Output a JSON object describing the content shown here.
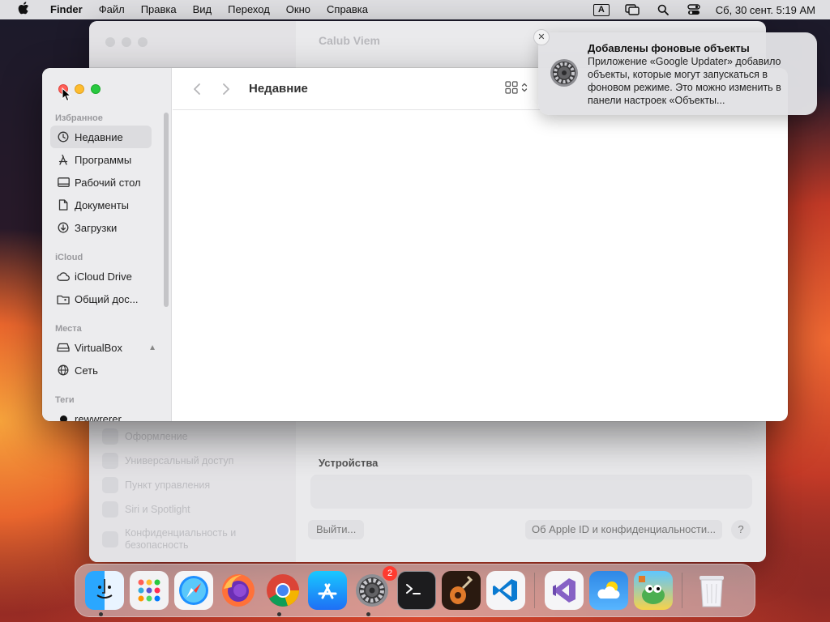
{
  "menubar": {
    "app_name": "Finder",
    "menus": [
      "Файл",
      "Правка",
      "Вид",
      "Переход",
      "Окно",
      "Справка"
    ],
    "input_indicator": "A",
    "clock": "Сб, 30 сент.  5:19 AM"
  },
  "settings_window": {
    "title": "Calub Viem",
    "sidebar_items": [
      "Оформление",
      "Универсальный доступ",
      "Пункт управления",
      "Siri и Spotlight",
      "Конфиденциальность и безопасность"
    ],
    "devices_label": "Устройства",
    "sign_out_label": "Выйти...",
    "about_label": "Об Apple ID и конфиденциальности...",
    "help_label": "?"
  },
  "finder": {
    "title": "Недавние",
    "sections": {
      "favorites": "Избранное",
      "icloud": "iCloud",
      "locations": "Места",
      "tags": "Теги"
    },
    "favorites": [
      "Недавние",
      "Программы",
      "Рабочий стол",
      "Документы",
      "Загрузки"
    ],
    "icloud_items": [
      "iCloud Drive",
      "Общий дос..."
    ],
    "locations": [
      "VirtualBox",
      "Сеть"
    ],
    "tags": [
      "rewwrerer"
    ]
  },
  "notification": {
    "title": "Добавлены фоновые объекты",
    "body": "Приложение «Google Updater» добавило объекты, которые могут запускаться в фоновом режиме. Это можно изменить в панели настроек «Объекты...",
    "close_glyph": "✕"
  },
  "dock": {
    "badge_count": "2",
    "apps": [
      "Finder",
      "Launchpad",
      "Safari",
      "Firefox",
      "Chrome",
      "App Store",
      "System Settings",
      "Terminal",
      "GarageBand",
      "Visual Studio Code",
      "Visual Studio",
      "Weather",
      "Game",
      "Trash"
    ]
  }
}
